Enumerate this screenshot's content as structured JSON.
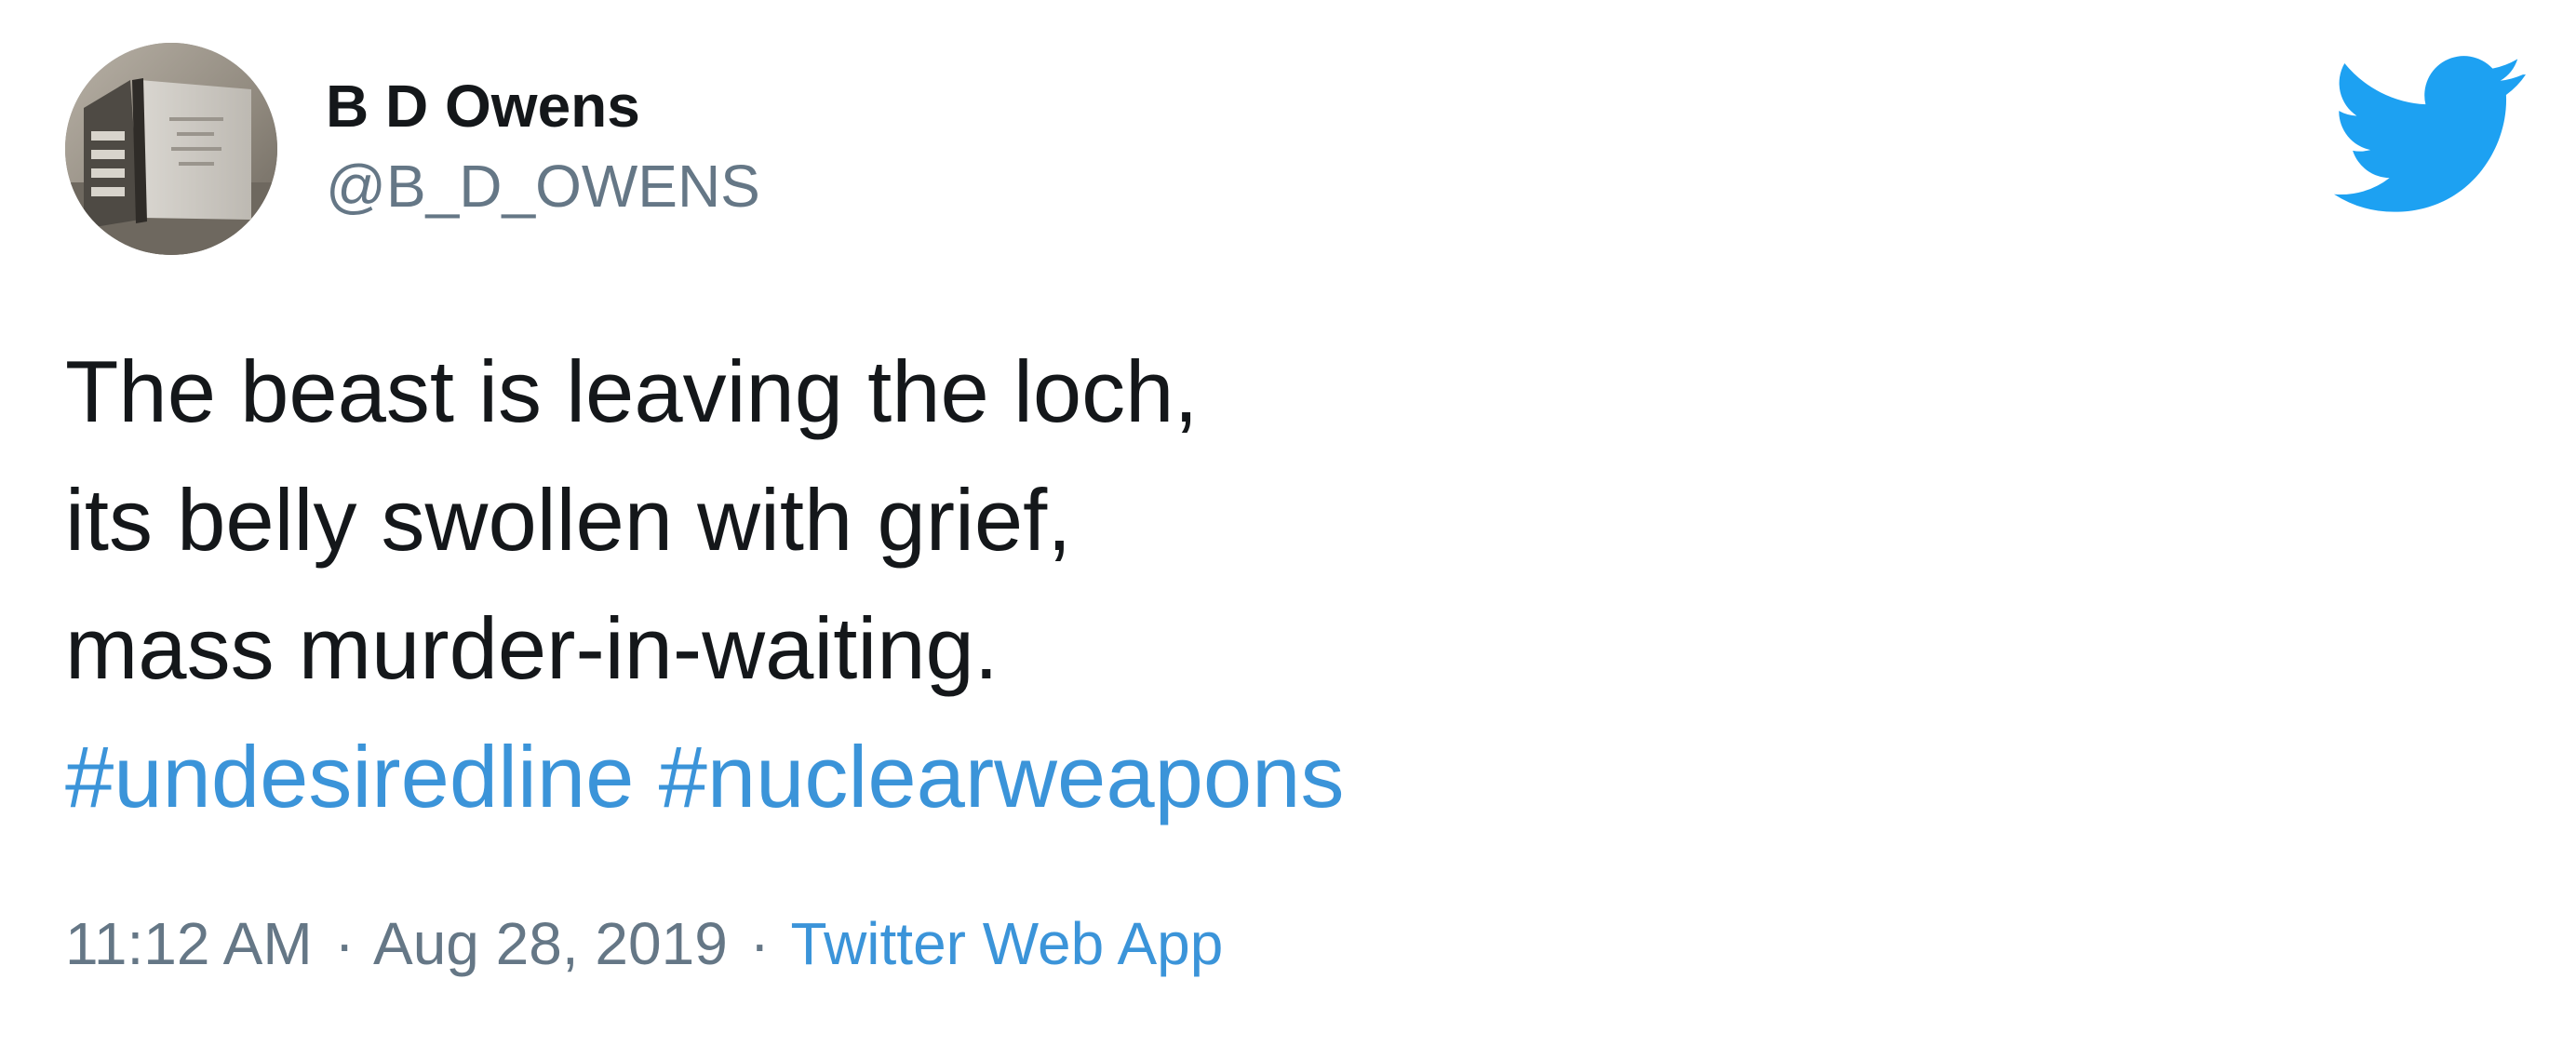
{
  "author": {
    "display_name": "B D Owens",
    "handle": "@B_D_OWENS",
    "avatar_icon": "book-avatar-icon"
  },
  "brand": {
    "logo_icon": "twitter-bird-icon",
    "logo_color": "#1da1f2"
  },
  "tweet": {
    "lines": [
      "The beast is leaving the loch,",
      "its belly swollen with grief,",
      "mass murder-in-waiting."
    ],
    "hashtags": [
      "#undesiredline",
      "#nuclearweapons"
    ],
    "time": "11:12 AM",
    "date": "Aug 28, 2019",
    "separator": "·",
    "source": "Twitter Web App"
  },
  "colors": {
    "text": "#14171a",
    "secondary": "#657786",
    "link": "#3b94d9"
  }
}
